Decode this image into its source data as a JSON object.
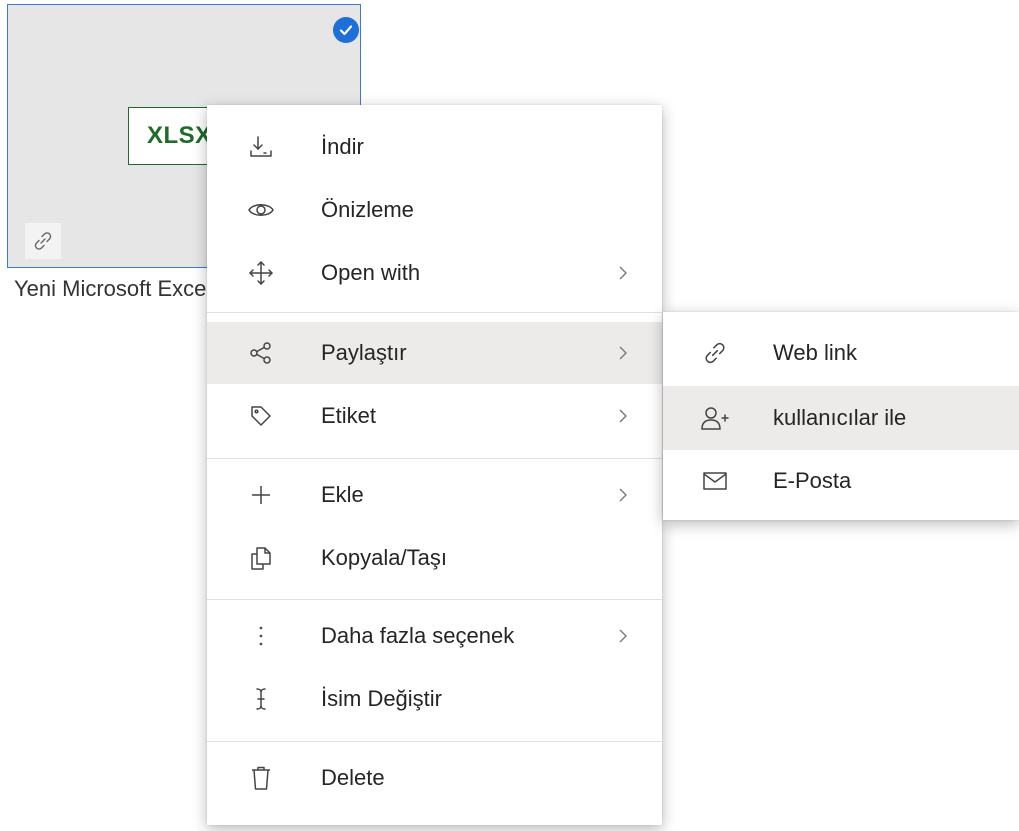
{
  "tile": {
    "badge": "XLSX",
    "file_name": "Yeni Microsoft Excel Çalışma Sayfası.xlsx",
    "selected": true,
    "accent": "#1f6fd9"
  },
  "menu": {
    "items": [
      {
        "label": "İndir",
        "icon": "download-icon",
        "submenu": false
      },
      {
        "label": "Önizleme",
        "icon": "eye-icon",
        "submenu": false
      },
      {
        "label": "Open with",
        "icon": "move-arrows-icon",
        "submenu": true
      },
      {
        "label": "Paylaştır",
        "icon": "share-icon",
        "submenu": true,
        "highlighted": true
      },
      {
        "label": "Etiket",
        "icon": "tag-icon",
        "submenu": true
      },
      {
        "label": "Ekle",
        "icon": "plus-icon",
        "submenu": true
      },
      {
        "label": "Kopyala/Taşı",
        "icon": "copy-icon",
        "submenu": false
      },
      {
        "label": "Daha fazla seçenek",
        "icon": "more-vertical-icon",
        "submenu": true
      },
      {
        "label": "İsim Değiştir",
        "icon": "text-cursor-icon",
        "submenu": false
      },
      {
        "label": "Delete",
        "icon": "trash-icon",
        "submenu": false
      }
    ]
  },
  "submenu": {
    "items": [
      {
        "label": "Web link",
        "icon": "link-icon"
      },
      {
        "label": "kullanıcılar ile",
        "icon": "add-user-icon",
        "highlighted": true
      },
      {
        "label": "E-Posta",
        "icon": "mail-icon"
      }
    ]
  },
  "colors": {
    "highlight": "#edebe9",
    "separator": "#e1dfdd",
    "excel_green": "#1e6b2a"
  }
}
